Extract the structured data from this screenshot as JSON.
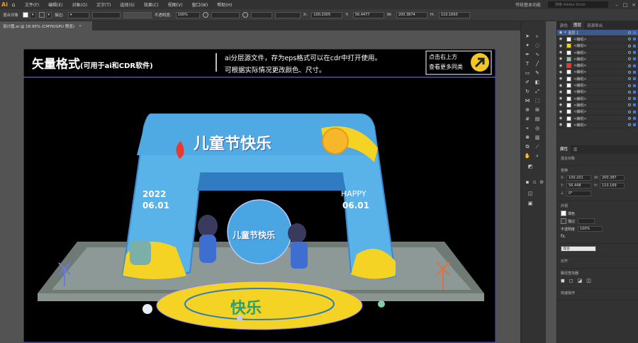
{
  "app": {
    "logo": "Ai",
    "workspace": "传统基本功能",
    "search_placeholder": "搜索 Adobe Stock"
  },
  "menu": [
    "文件(F)",
    "编辑(E)",
    "对象(O)",
    "文字(T)",
    "选择(S)",
    "效果(C)",
    "视图(V)",
    "窗口(W)",
    "帮助(H)"
  ],
  "control": {
    "selection": "混合对象",
    "stroke_label": "描边:",
    "opacity_label": "不透明度:",
    "opacity": "100%",
    "x": "100.2005",
    "y": "56.4477",
    "w": "200.3874",
    "h": "110.1693"
  },
  "doc_tab": {
    "title": "设计图.ai @ 18.95% (CMYK/GPU 预览)",
    "close": "×"
  },
  "banner": {
    "title": "矢量格式",
    "title_sub": "(可用于ai和CDR软件)",
    "line1": "ai分层源文件，存为eps格式可以在cdr中打开使用。",
    "line2": "可根据实际情况更改颜色、尺寸。",
    "cta1": "点击右上方",
    "cta2": "查看更多同类"
  },
  "art": {
    "arch_title": "儿童节快乐",
    "date_year": "2022",
    "date_day": "06.01",
    "happy": "HAPPY",
    "happy_date": "06.01",
    "center_text": "儿童节快乐",
    "floor_text": "快乐"
  },
  "panels": {
    "tabs_top": [
      "颜色",
      "图层",
      "资源导出"
    ],
    "layers": [
      "图层 1",
      "<编组>",
      "<编组>",
      "<编组>",
      "<编组>",
      "<编组>",
      "<编组>",
      "<编组>",
      "<编组>",
      "<编组>",
      "<编组>",
      "<编组>",
      "<编组>",
      "<编组>",
      "<编组>"
    ],
    "tabs_bottom": [
      "属性",
      "库"
    ],
    "prop": {
      "section1": "混合对象",
      "transform": "变换",
      "x": "100.201",
      "w": "200.387",
      "y": "56.448",
      "h": "110.169",
      "angle": "0°",
      "appearance": "外观",
      "fill": "填色",
      "stroke": "描边",
      "opacity": "不透明度",
      "opacity_val": "100%",
      "fx": "fx.",
      "blend_label": "混合",
      "align": "对齐",
      "pathfinder": "路径查找器",
      "quick": "快速操作"
    }
  },
  "colors": {
    "accent": "#3d5a8a",
    "arch_blue": "#5ab3e8",
    "arch_yellow": "#f4d324",
    "floor": "#8a9590"
  }
}
